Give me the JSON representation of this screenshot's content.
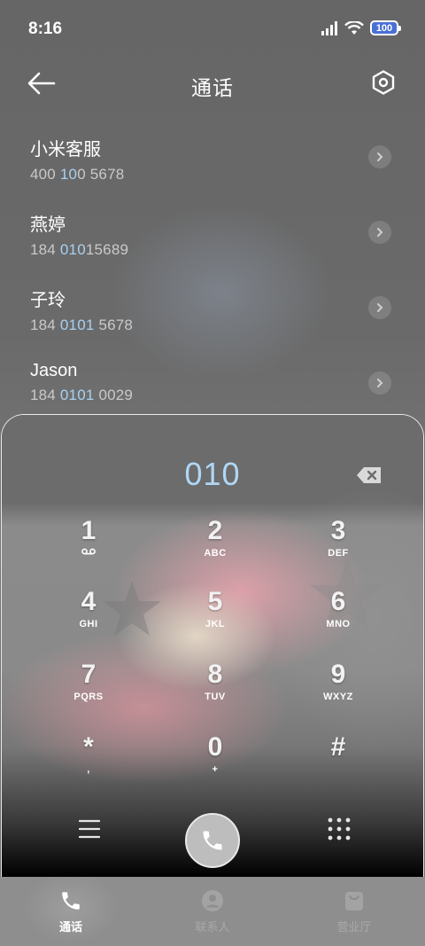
{
  "status_bar": {
    "time": "8:16",
    "battery": "100"
  },
  "header": {
    "title": "通话",
    "back_icon": "arrow-left-icon",
    "settings_icon": "gear-icon"
  },
  "contacts": [
    {
      "name": "小米客服",
      "num_pre": "400 ",
      "num_hl": "10",
      "num_post": "0 5678"
    },
    {
      "name": "燕婷",
      "num_pre": "184 ",
      "num_hl": "010",
      "num_post": "15689"
    },
    {
      "name": "子玲",
      "num_pre": "184 ",
      "num_hl": "0101",
      "num_post": " 5678"
    },
    {
      "name": "Jason",
      "num_pre": "184 ",
      "num_hl": "0101",
      "num_post": " 0029"
    }
  ],
  "dialer": {
    "input": "010",
    "keys": [
      {
        "digit": "1",
        "letters": "voicemail"
      },
      {
        "digit": "2",
        "letters": "ABC"
      },
      {
        "digit": "3",
        "letters": "DEF"
      },
      {
        "digit": "4",
        "letters": "GHI"
      },
      {
        "digit": "5",
        "letters": "JKL"
      },
      {
        "digit": "6",
        "letters": "MNO"
      },
      {
        "digit": "7",
        "letters": "PQRS"
      },
      {
        "digit": "8",
        "letters": "TUV"
      },
      {
        "digit": "9",
        "letters": "WXYZ"
      },
      {
        "digit": "*",
        "letters": ","
      },
      {
        "digit": "0",
        "letters": "+"
      },
      {
        "digit": "#",
        "letters": ""
      }
    ]
  },
  "nav": {
    "calls": "通话",
    "contacts": "联系人",
    "service": "营业厅"
  },
  "colors": {
    "highlight": "#a7d1f2",
    "input_digits": "#b0d7f5",
    "battery": "#4a70d6"
  }
}
